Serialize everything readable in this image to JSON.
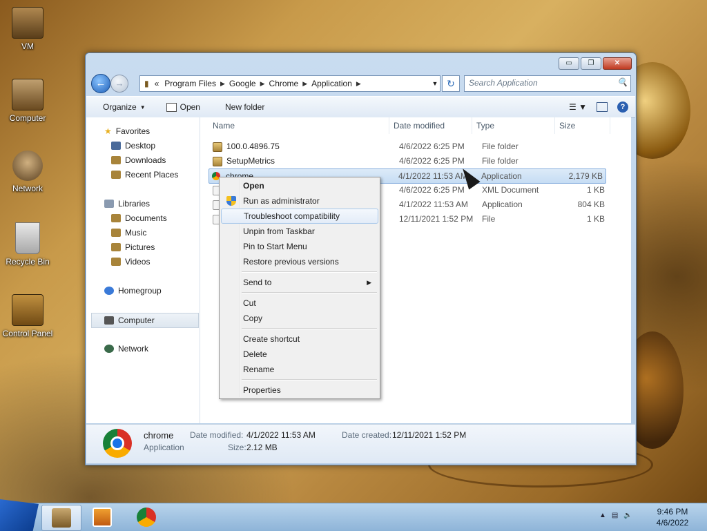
{
  "desktop": {
    "icons": [
      {
        "label": "VM",
        "icon": "folder-icon"
      },
      {
        "label": "Computer",
        "icon": "computer-icon"
      },
      {
        "label": "Network",
        "icon": "network-icon"
      },
      {
        "label": "Recycle Bin",
        "icon": "recycle-bin-icon"
      },
      {
        "label": "Control Panel",
        "icon": "control-panel-icon"
      }
    ]
  },
  "window": {
    "controls": {
      "minimize": "▭",
      "maximize": "❐",
      "close": "✕"
    },
    "address": {
      "overflow": "«",
      "crumbs": [
        "Program Files",
        "Google",
        "Chrome",
        "Application"
      ]
    },
    "search_placeholder": "Search Application",
    "toolbar": {
      "organize": "Organize",
      "open": "Open",
      "new_folder": "New folder"
    },
    "nav": {
      "favorites": "Favorites",
      "desktop": "Desktop",
      "downloads": "Downloads",
      "recent": "Recent Places",
      "libraries": "Libraries",
      "documents": "Documents",
      "music": "Music",
      "pictures": "Pictures",
      "videos": "Videos",
      "homegroup": "Homegroup",
      "computer": "Computer",
      "network": "Network"
    },
    "columns": {
      "name": "Name",
      "date": "Date modified",
      "type": "Type",
      "size": "Size"
    },
    "files": [
      {
        "name": "100.0.4896.75",
        "date": "4/6/2022 6:25 PM",
        "type": "File folder",
        "size": "",
        "icon": "folder-icon"
      },
      {
        "name": "SetupMetrics",
        "date": "4/6/2022 6:25 PM",
        "type": "File folder",
        "size": "",
        "icon": "folder-icon"
      },
      {
        "name": "chrome",
        "date": "4/1/2022 11:53 AM",
        "type": "Application",
        "size": "2,179 KB",
        "icon": "chrome-icon"
      },
      {
        "name": "",
        "date": "4/6/2022 6:25 PM",
        "type": "XML Document",
        "size": "1 KB",
        "icon": "xml-icon"
      },
      {
        "name": "",
        "date": "4/1/2022 11:53 AM",
        "type": "Application",
        "size": "804 KB",
        "icon": "app-icon"
      },
      {
        "name": "",
        "date": "12/11/2021 1:52 PM",
        "type": "File",
        "size": "1 KB",
        "icon": "file-icon"
      }
    ],
    "details": {
      "name": "chrome",
      "type": "Application",
      "date_modified_label": "Date modified:",
      "date_modified": "4/1/2022 11:53 AM",
      "date_created_label": "Date created:",
      "date_created": "12/11/2021 1:52 PM",
      "size_label": "Size:",
      "size": "2.12 MB"
    }
  },
  "context_menu": {
    "open": "Open",
    "run_admin": "Run as administrator",
    "troubleshoot": "Troubleshoot compatibility",
    "unpin": "Unpin from Taskbar",
    "pin_start": "Pin to Start Menu",
    "restore": "Restore previous versions",
    "send_to": "Send to",
    "cut": "Cut",
    "copy": "Copy",
    "create_shortcut": "Create shortcut",
    "delete": "Delete",
    "rename": "Rename",
    "properties": "Properties"
  },
  "taskbar": {
    "time": "9:46 PM",
    "date": "4/6/2022"
  }
}
